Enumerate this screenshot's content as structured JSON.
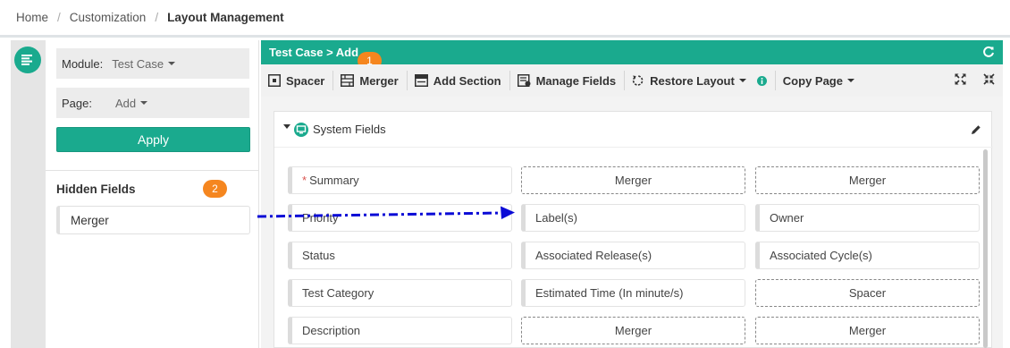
{
  "breadcrumb": {
    "home": "Home",
    "customization": "Customization",
    "current": "Layout Management",
    "separator": "/"
  },
  "left_panel": {
    "module_label": "Module:",
    "module_value": "Test Case",
    "page_label": "Page:",
    "page_value": "Add",
    "apply_label": "Apply",
    "hidden_fields_title": "Hidden Fields",
    "hidden_fields": [
      "Merger"
    ]
  },
  "header": {
    "title": "Test Case > Add"
  },
  "toolbar": {
    "spacer": "Spacer",
    "merger": "Merger",
    "add_section": "Add Section",
    "manage_fields": "Manage Fields",
    "restore_layout": "Restore Layout",
    "copy_page": "Copy Page"
  },
  "section": {
    "title": "System Fields"
  },
  "fields": {
    "r1c1": "Summary",
    "r1c2": "Merger",
    "r1c3": "Merger",
    "r2c1": "Priority",
    "r2c2": "Label(s)",
    "r2c3": "Owner",
    "r3c1": "Status",
    "r3c2": "Associated Release(s)",
    "r3c3": "Associated Cycle(s)",
    "r4c1": "Test Category",
    "r4c2": "Estimated Time (In minute/s)",
    "r4c3": "Spacer",
    "r5c1": "Description",
    "r5c2": "Merger",
    "r5c3": "Merger",
    "required_mark": "*"
  },
  "annotations": {
    "badge1": "1",
    "badge2": "2"
  },
  "colors": {
    "accent": "#1aaa8e",
    "badge": "#f5861f",
    "arrow": "#0b0bd6"
  }
}
